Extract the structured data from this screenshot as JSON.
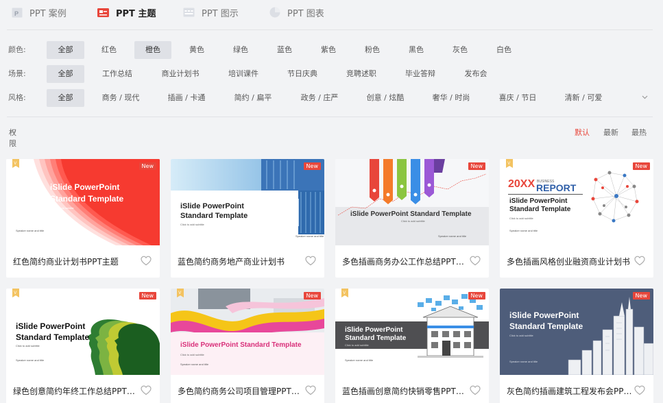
{
  "tabs": [
    {
      "label": "PPT 案例",
      "icon": "document-icon",
      "active": false
    },
    {
      "label": "PPT 主题",
      "icon": "theme-icon",
      "active": true
    },
    {
      "label": "PPT 图示",
      "icon": "diagram-icon",
      "active": false
    },
    {
      "label": "PPT 图表",
      "icon": "pie-chart-icon",
      "active": false
    }
  ],
  "filters": {
    "color": {
      "label": "颜色:",
      "options": [
        "全部",
        "红色",
        "橙色",
        "黄色",
        "绿色",
        "蓝色",
        "紫色",
        "粉色",
        "黑色",
        "灰色",
        "白色"
      ],
      "selected": [
        "全部",
        "橙色"
      ]
    },
    "scene": {
      "label": "场景:",
      "options": [
        "全部",
        "工作总结",
        "商业计划书",
        "培训课件",
        "节日庆典",
        "竞聘述职",
        "毕业答辩",
        "发布会"
      ],
      "selected": [
        "全部"
      ]
    },
    "style": {
      "label": "风格:",
      "options": [
        "全部",
        "商务 / 现代",
        "插画 / 卡通",
        "简约 / 扁平",
        "政务 / 庄严",
        "创意 / 炫酷",
        "奢华 / 时尚",
        "喜庆 / 节日",
        "清新 / 可爱"
      ],
      "selected": [
        "全部"
      ]
    }
  },
  "sort": {
    "permission_label": "权限",
    "options": [
      "默认",
      "最新",
      "最热"
    ],
    "active": "默认"
  },
  "accent_color": "#e8463b",
  "cards": [
    {
      "title": "红色简约商业计划书PPT主题",
      "badge": "New",
      "vip": true,
      "thumb_title": [
        "iSlide PowerPoint",
        "Standard Template"
      ],
      "thumb_sub": "Click to add subtitle",
      "thumb_meta": "Speaker name and title"
    },
    {
      "title": "蓝色简约商务地产商业计划书",
      "badge": "New",
      "vip": false,
      "thumb_title": [
        "iSlide PowerPoint",
        "Standard Template"
      ],
      "thumb_sub": "Click to add subtitle",
      "thumb_meta": "Speaker name and title"
    },
    {
      "title": "多色插画商务办公工作总结PPT主题",
      "badge": "New",
      "vip": false,
      "thumb_title": [
        "iSlide PowerPoint Standard Template"
      ],
      "thumb_sub": "Click to add subtitle",
      "thumb_meta": "Speaker name and title"
    },
    {
      "title": "多色插画风格创业融资商业计划书",
      "badge": "New",
      "vip": true,
      "thumb_title": [
        "iSlide PowerPoint",
        "Standard Template"
      ],
      "thumb_sub": "Click to add subtitle",
      "thumb_meta": "Speaker name and title",
      "thumb_year": "20XX",
      "thumb_business": "BUSINESS",
      "thumb_report": "REPORT"
    },
    {
      "title": "绿色创意简约年终工作总结PPT主题",
      "badge": "New",
      "vip": true,
      "thumb_title": [
        "iSlide PowerPoint",
        "Standard Template"
      ],
      "thumb_sub": "Click to add subtitle",
      "thumb_meta": "Speaker name and title"
    },
    {
      "title": "多色简约商务公司项目管理PPT主题",
      "badge": "New",
      "vip": true,
      "thumb_title": [
        "iSlide PowerPoint Standard Template"
      ],
      "thumb_sub": "Click to add subtitle",
      "thumb_meta": "Speaker name and title"
    },
    {
      "title": "蓝色插画创意简约快销零售PPT主题",
      "badge": "New",
      "vip": true,
      "thumb_title": [
        "iSlide PowerPoint",
        "Standard Template"
      ],
      "thumb_sub": "Click to add subtitle",
      "thumb_meta": "Speaker name and title"
    },
    {
      "title": "灰色简约插画建筑工程发布会PPT主题",
      "badge": "New",
      "vip": false,
      "thumb_title": [
        "iSlide PowerPoint",
        "Standard Template"
      ],
      "thumb_sub": "Click to add subtitle",
      "thumb_meta": "Speaker name and title"
    }
  ]
}
